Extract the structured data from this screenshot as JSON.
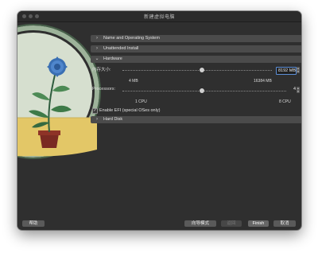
{
  "window": {
    "title": "新建虚拟电脑"
  },
  "sections": {
    "name_os": "Name and Operating System",
    "unattended": "Unattended Install",
    "hardware": "Hardware",
    "hard_disk": "Hard Disk"
  },
  "hardware": {
    "memory_label": "内存大小:",
    "memory_value": "8192 MB",
    "memory_min": "4 MB",
    "memory_max": "16384 MB",
    "processors_label": "Processors:",
    "processors_value": "4",
    "processors_min": "1 CPU",
    "processors_max": "8 CPU",
    "efi_label": "Enable EFI (special OSes only)",
    "efi_checked": true
  },
  "buttons": {
    "help": "帮助",
    "expert_mode": "向导模式",
    "back": "返回",
    "finish": "Finish",
    "cancel": "取消"
  },
  "icons": {
    "section_collapsed": "chevron-right-icon",
    "section_expanded": "chevron-down-icon",
    "checkmark": "check-icon"
  }
}
